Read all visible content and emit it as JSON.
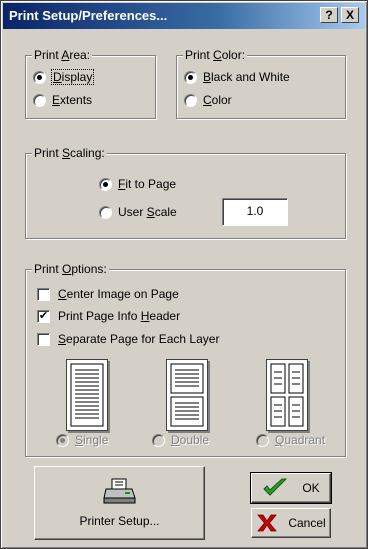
{
  "window": {
    "title": "Print Setup/Preferences...",
    "help_button": "?",
    "close_button": "X"
  },
  "print_area": {
    "label": "Print Area:",
    "options": [
      {
        "label": "Display",
        "checked": true
      },
      {
        "label": "Extents",
        "checked": false
      }
    ]
  },
  "print_color": {
    "label": "Print Color:",
    "options": [
      {
        "label": "Black and White",
        "checked": true
      },
      {
        "label": "Color",
        "checked": false
      }
    ]
  },
  "print_scaling": {
    "label": "Print Scaling:",
    "options": [
      {
        "label": "Fit to Page",
        "checked": true
      },
      {
        "label": "User Scale",
        "checked": false
      }
    ],
    "user_scale_value": "1.0"
  },
  "print_options": {
    "label": "Print Options:",
    "checkboxes": [
      {
        "label": "Center Image on Page",
        "checked": false
      },
      {
        "label": "Print Page Info Header",
        "checked": true
      },
      {
        "label": "Separate Page for Each Layer",
        "checked": false
      }
    ],
    "layouts": [
      {
        "label": "Single",
        "checked": true,
        "icon": "single-page-layout-icon"
      },
      {
        "label": "Double",
        "checked": false,
        "icon": "double-page-layout-icon"
      },
      {
        "label": "Quadrant",
        "checked": false,
        "icon": "quadrant-page-layout-icon"
      }
    ]
  },
  "buttons": {
    "printer_setup": "Printer Setup...",
    "ok": "OK",
    "cancel": "Cancel"
  },
  "colors": {
    "title_start": "#0a246a",
    "title_end": "#a6caf0",
    "face": "#d4d0c8",
    "ok_check": "#2a9d2a",
    "cancel_x": "#cc0000"
  }
}
